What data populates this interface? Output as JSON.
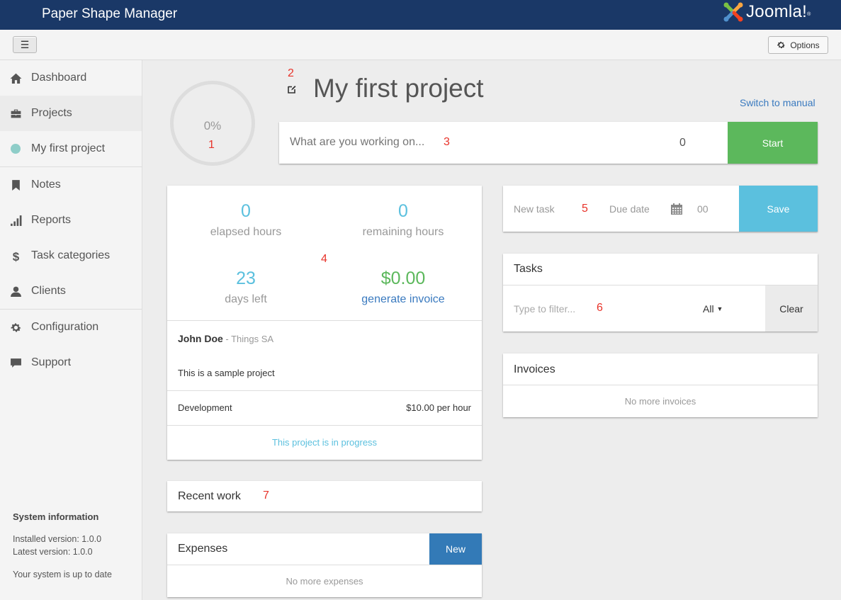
{
  "header": {
    "app_title": "Paper Shape Manager",
    "brand": "Joomla!",
    "brand_mark": "®"
  },
  "toolbar": {
    "menu_toggle_icon": "☰",
    "options_label": "Options"
  },
  "sidebar": {
    "items": [
      {
        "label": "Dashboard",
        "icon": "home-icon"
      },
      {
        "label": "Projects",
        "icon": "briefcase-icon",
        "active": true
      },
      {
        "label": "My first project",
        "icon": "project-color-dot"
      },
      {
        "label": "Notes",
        "icon": "bookmark-icon"
      },
      {
        "label": "Reports",
        "icon": "signal-bars-icon"
      },
      {
        "label": "Task categories",
        "icon": "dollar-icon"
      },
      {
        "label": "Clients",
        "icon": "user-icon"
      },
      {
        "label": "Configuration",
        "icon": "gear-icon"
      },
      {
        "label": "Support",
        "icon": "speech-bubble-icon"
      }
    ],
    "system_info": {
      "heading": "System information",
      "installed": "Installed version: 1.0.0",
      "latest": "Latest version: 1.0.0",
      "status": "Your system is up to date"
    }
  },
  "colors": {
    "header_bg": "#1a3867",
    "success": "#5cb85c",
    "info": "#5bc0de",
    "primary": "#337ab7",
    "link": "#3a7abf",
    "project_dot": "#8ecdc8",
    "annotation": "#e8332a"
  },
  "project": {
    "progress_percent": 0,
    "progress_label": "0%",
    "title": "My first project",
    "switch_manual": "Switch to manual"
  },
  "timer": {
    "placeholder": "What are you working on...",
    "count": "0",
    "start_label": "Start"
  },
  "stats": {
    "elapsed_value": "0",
    "elapsed_label": "elapsed hours",
    "remaining_value": "0",
    "remaining_label": "remaining hours",
    "days_value": "23",
    "days_label": "days left",
    "invoice_value": "$0.00",
    "invoice_link": "generate invoice",
    "client_name": "John Doe",
    "client_company": " - Things SA",
    "description": "This is a sample project",
    "category": "Development",
    "rate": "$10.00 per hour",
    "status": "This project is in progress"
  },
  "new_task": {
    "placeholder": "New task",
    "due_placeholder": "Due date",
    "hours": "00",
    "save_label": "Save"
  },
  "tasks": {
    "title": "Tasks",
    "filter_placeholder": "Type to filter...",
    "filter_select": "All",
    "clear_label": "Clear"
  },
  "invoices": {
    "title": "Invoices",
    "empty": "No more invoices"
  },
  "recent_work": {
    "title": "Recent work"
  },
  "expenses": {
    "title": "Expenses",
    "new_label": "New",
    "empty": "No more expenses"
  },
  "annotations": [
    "1",
    "2",
    "3",
    "4",
    "5",
    "6",
    "7"
  ]
}
